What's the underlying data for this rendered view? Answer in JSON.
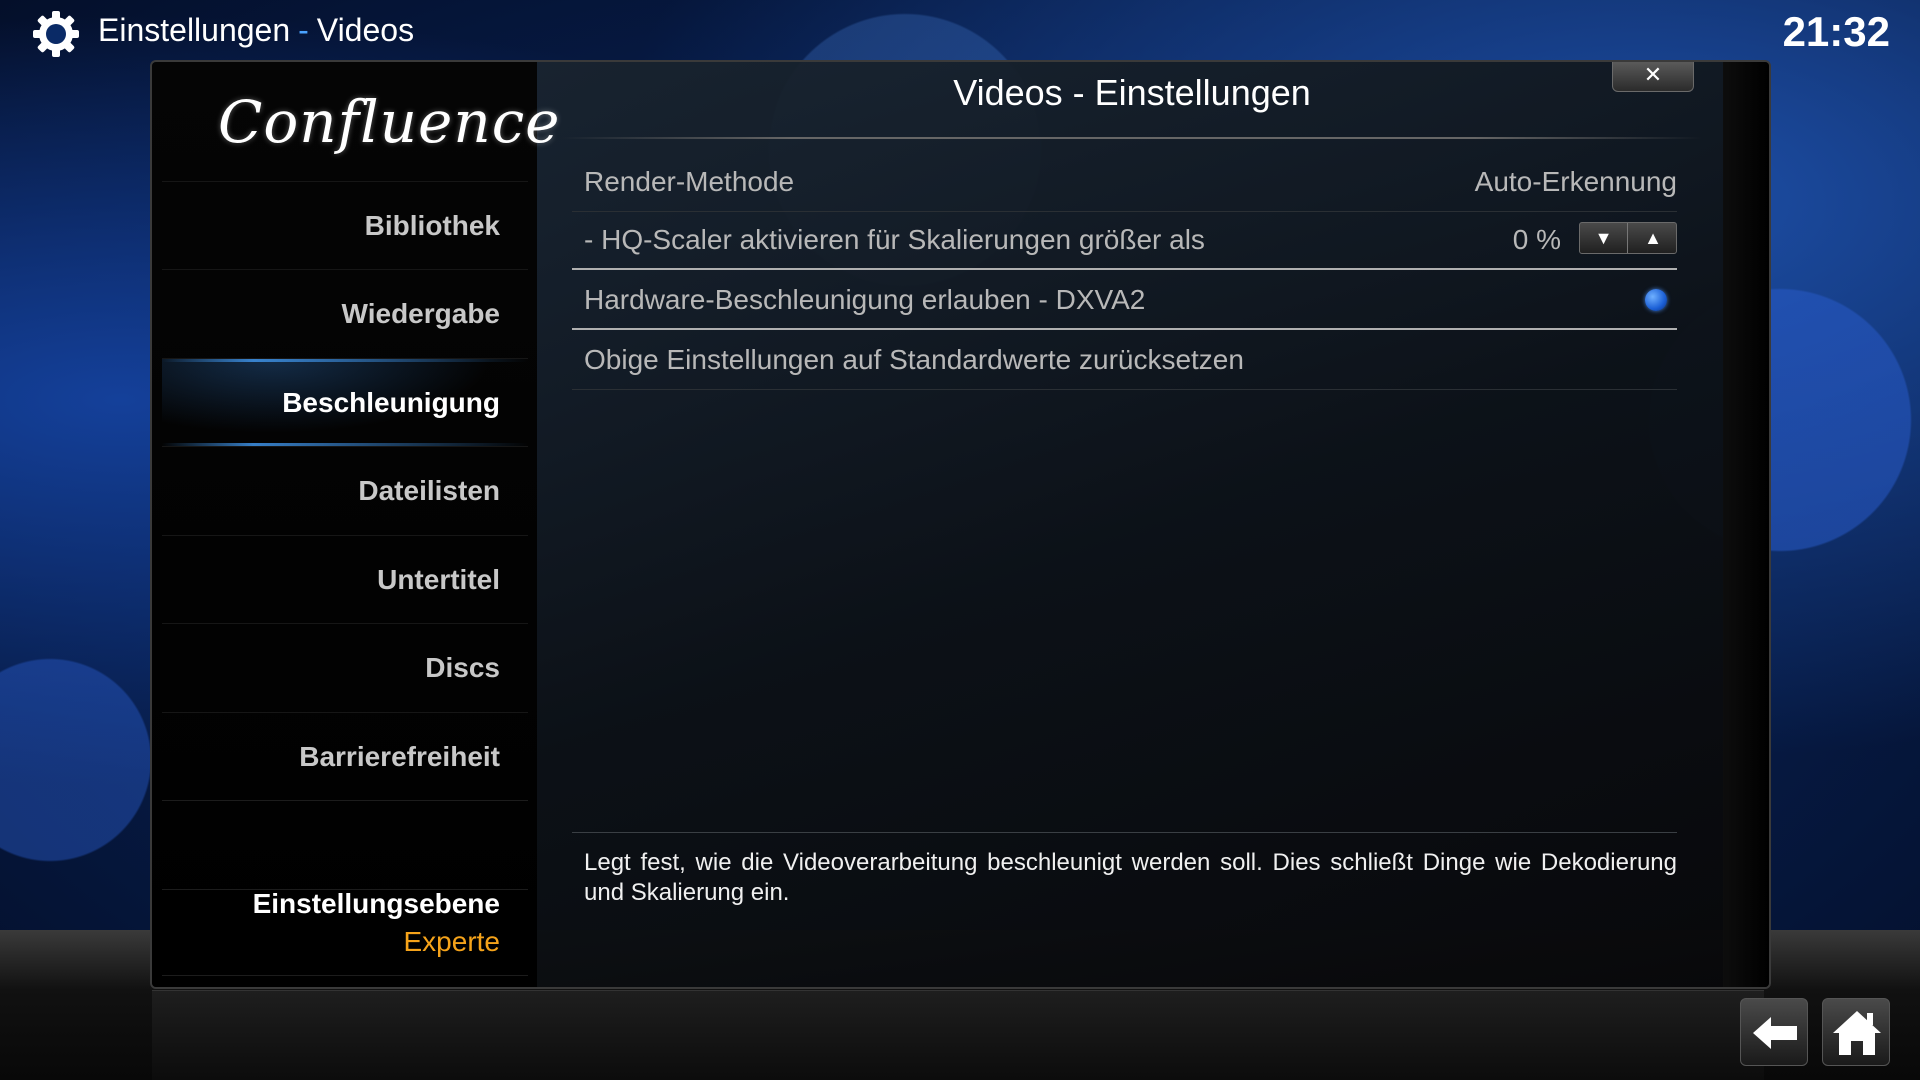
{
  "header": {
    "section": "Einstellungen",
    "separator": "-",
    "page": "Videos",
    "clock": "21:32"
  },
  "dialog": {
    "title": "Videos - Einstellungen",
    "logo_text": "Confluence",
    "close_label": "✕"
  },
  "sidebar": {
    "items": [
      {
        "label": "Bibliothek"
      },
      {
        "label": "Wiedergabe"
      },
      {
        "label": "Beschleunigung"
      },
      {
        "label": "Dateilisten"
      },
      {
        "label": "Untertitel"
      },
      {
        "label": "Discs"
      },
      {
        "label": "Barrierefreiheit"
      }
    ],
    "active_index": 2,
    "level_label": "Einstellungsebene",
    "level_value": "Experte"
  },
  "settings": {
    "render_method": {
      "label": "Render-Methode",
      "value": "Auto-Erkennung"
    },
    "hq_scaler": {
      "label": "- HQ-Scaler aktivieren für Skalierungen größer als",
      "value": "0 %"
    },
    "hw_accel": {
      "label": "Hardware-Beschleunigung erlauben - DXVA2",
      "enabled": true
    },
    "reset": {
      "label": "Obige Einstellungen auf Standardwerte zurücksetzen"
    }
  },
  "description": "Legt fest, wie die Videoverarbeitung beschleunigt werden soll. Dies schließt Dinge wie Dekodierung und Skalierung ein.",
  "colors": {
    "accent_blue": "#4aa3ff",
    "level_orange": "#f5a31a"
  },
  "icons": {
    "header": "gear-icon",
    "spinner_down": "triangle-down-icon",
    "spinner_up": "triangle-up-icon",
    "back": "back-arrow-icon",
    "home": "home-icon"
  }
}
